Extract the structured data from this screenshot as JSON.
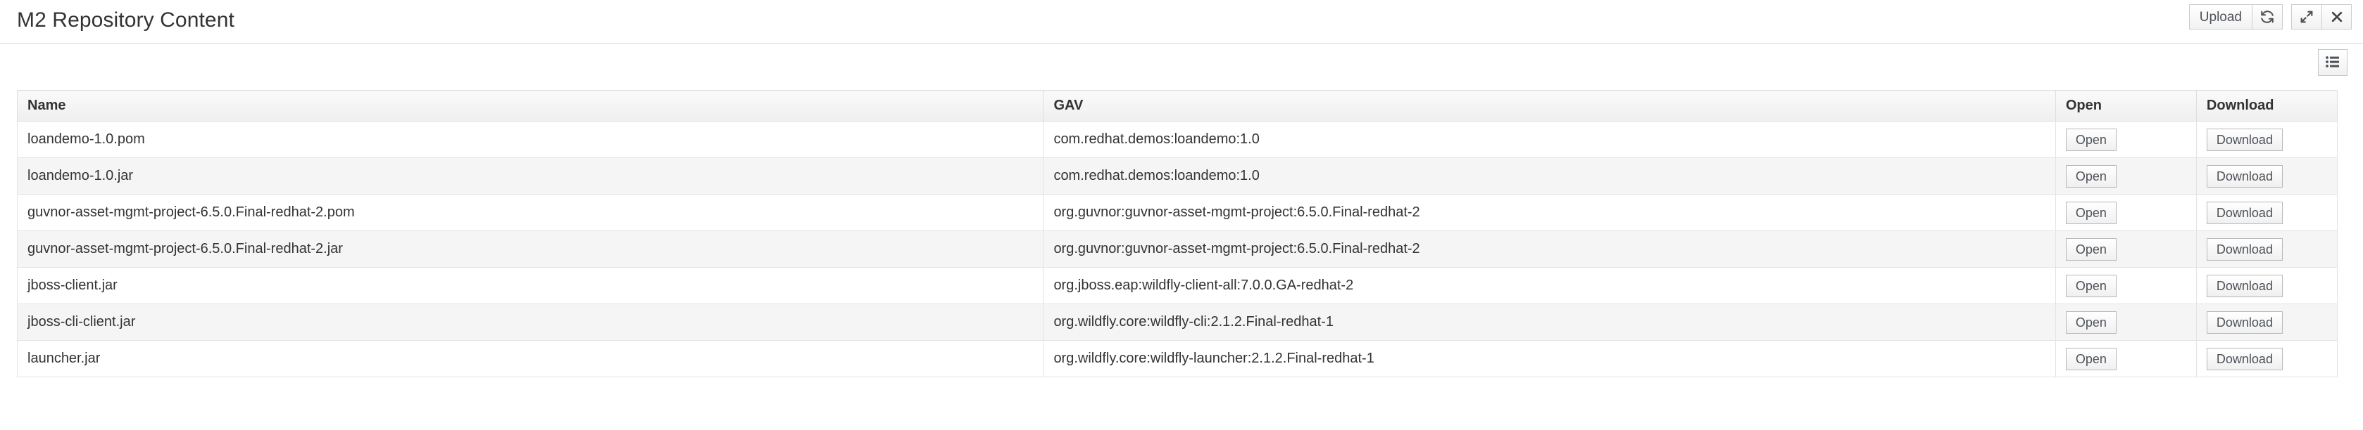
{
  "header": {
    "title": "M2 Repository Content",
    "actions": [
      {
        "name": "upload-button",
        "label": "Upload",
        "icon": "",
        "type": "text"
      },
      {
        "name": "refresh-button",
        "label": "",
        "icon": "refresh-icon",
        "type": "icon"
      },
      {
        "name": "maximize-button",
        "label": "",
        "icon": "expand-icon",
        "type": "icon"
      },
      {
        "name": "close-button",
        "label": "",
        "icon": "close-icon",
        "type": "icon"
      }
    ]
  },
  "toolbar": {
    "view_toggle_label": "",
    "view_toggle_icon": "list-icon"
  },
  "table": {
    "columns": [
      {
        "key": "name",
        "label": "Name"
      },
      {
        "key": "gav",
        "label": "GAV"
      },
      {
        "key": "open",
        "label": "Open"
      },
      {
        "key": "download",
        "label": "Download"
      }
    ],
    "open_label": "Open",
    "download_label": "Download",
    "rows": [
      {
        "name": "loandemo-1.0.pom",
        "gav": "com.redhat.demos:loandemo:1.0",
        "open": "Open",
        "download": "Download"
      },
      {
        "name": "loandemo-1.0.jar",
        "gav": "com.redhat.demos:loandemo:1.0",
        "open": "Open",
        "download": "Download"
      },
      {
        "name": "guvnor-asset-mgmt-project-6.5.0.Final-redhat-2.pom",
        "gav": "org.guvnor:guvnor-asset-mgmt-project:6.5.0.Final-redhat-2",
        "open": "Open",
        "download": "Download"
      },
      {
        "name": "guvnor-asset-mgmt-project-6.5.0.Final-redhat-2.jar",
        "gav": "org.guvnor:guvnor-asset-mgmt-project:6.5.0.Final-redhat-2",
        "open": "Open",
        "download": "Download"
      },
      {
        "name": "jboss-client.jar",
        "gav": "org.jboss.eap:wildfly-client-all:7.0.0.GA-redhat-2",
        "open": "Open",
        "download": "Download"
      },
      {
        "name": "jboss-cli-client.jar",
        "gav": "org.wildfly.core:wildfly-cli:2.1.2.Final-redhat-1",
        "open": "Open",
        "download": "Download"
      },
      {
        "name": "launcher.jar",
        "gav": "org.wildfly.core:wildfly-launcher:2.1.2.Final-redhat-1",
        "open": "Open",
        "download": "Download"
      }
    ]
  },
  "colors": {
    "text": "#333333",
    "button_text": "#4d5258",
    "border": "#dddddd",
    "stripe": "#f5f5f5"
  }
}
